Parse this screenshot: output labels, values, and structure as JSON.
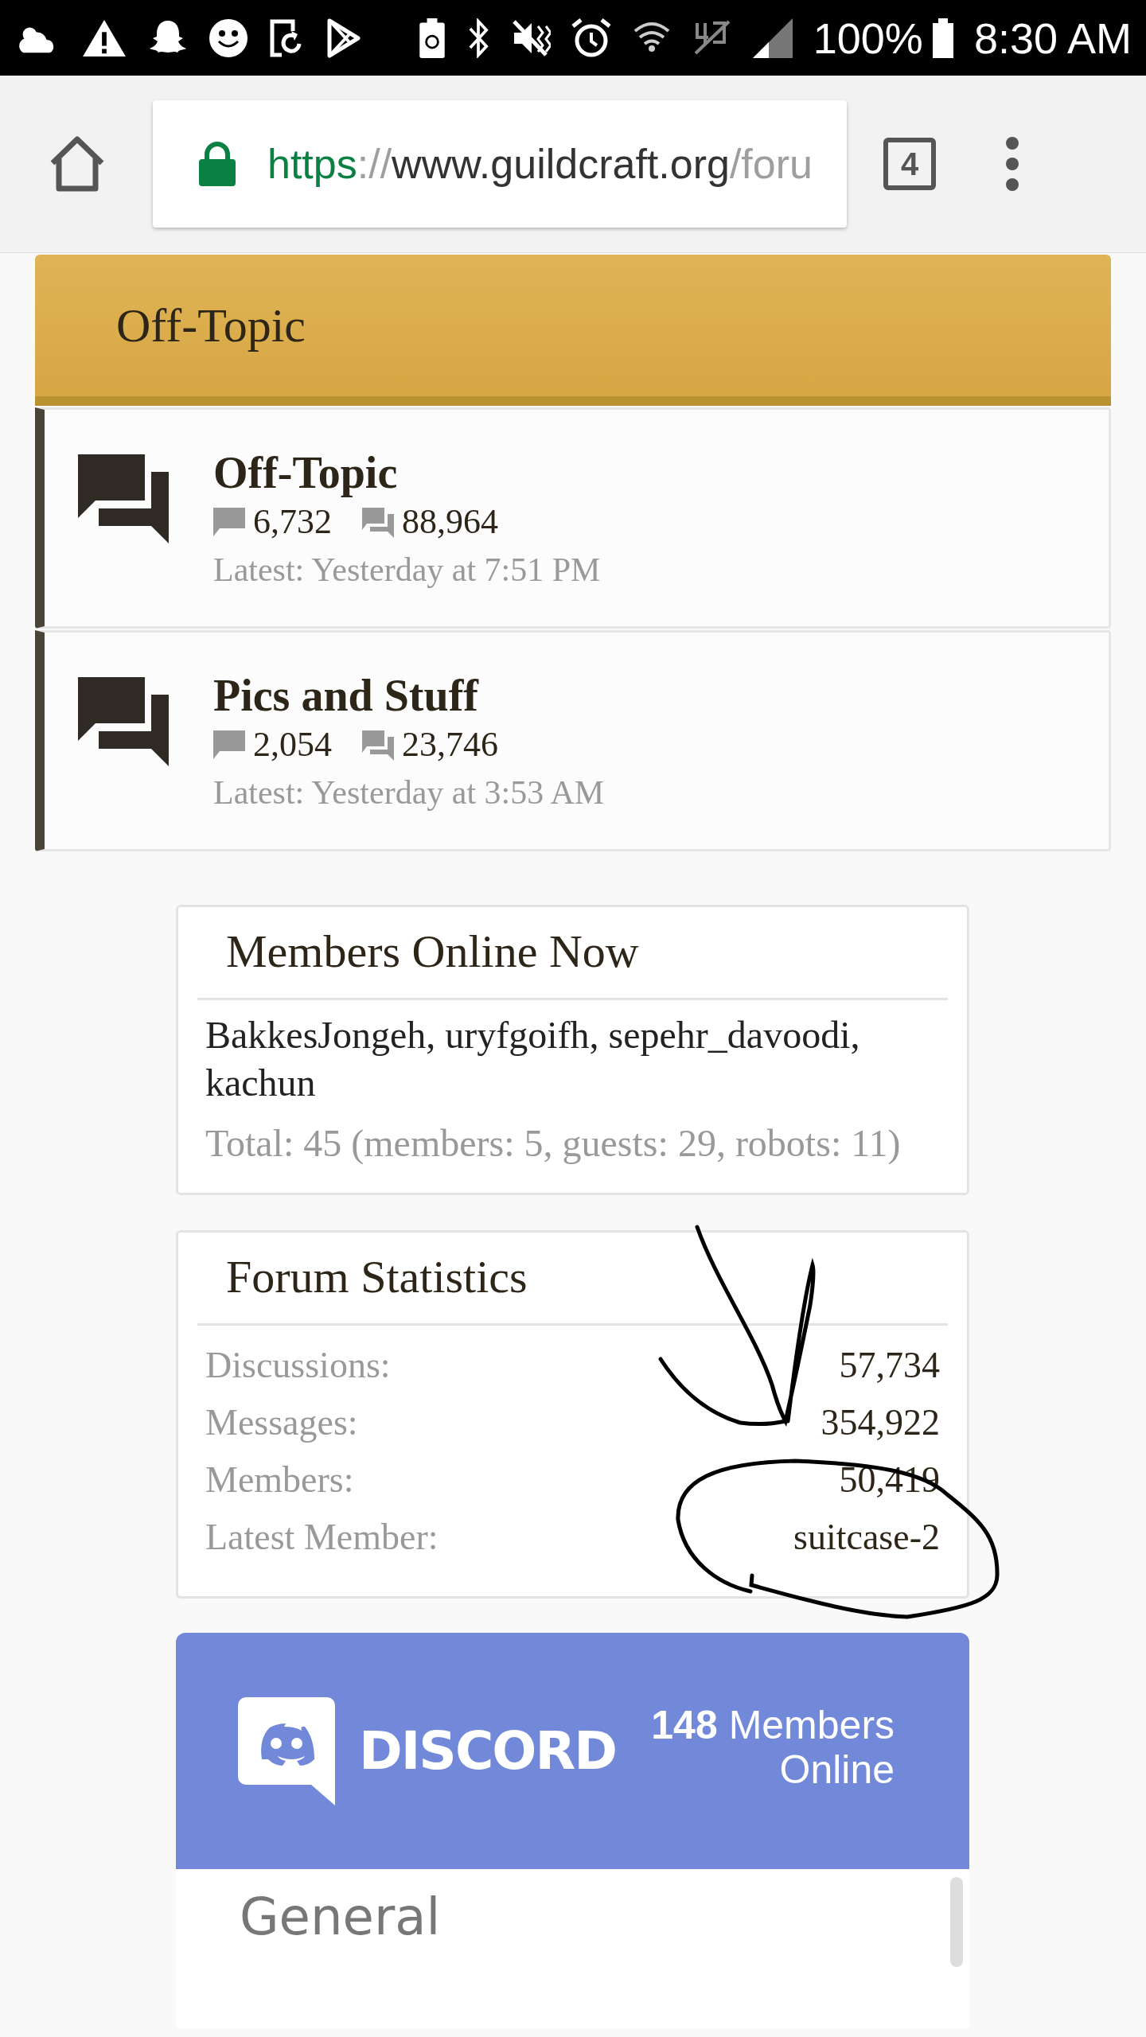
{
  "status_bar": {
    "battery": "100%",
    "time": "8:30 AM"
  },
  "browser": {
    "url": {
      "scheme": "https",
      "separator": "://",
      "host": "www.guildcraft.org",
      "path": "/foru"
    },
    "tab_count": "4"
  },
  "category": {
    "title": "Off-Topic"
  },
  "forums": [
    {
      "title": "Off-Topic",
      "threads": "6,732",
      "messages": "88,964",
      "latest": "Latest: Yesterday at 7:51 PM"
    },
    {
      "title": "Pics and Stuff",
      "threads": "2,054",
      "messages": "23,746",
      "latest": "Latest: Yesterday at 3:53 AM"
    }
  ],
  "members_online": {
    "title": "Members Online Now",
    "members": "BakkesJongeh, uryfgoifh, sepehr_davoodi, kachun",
    "total": "Total: 45 (members: 5, guests: 29, robots: 11)"
  },
  "forum_statistics": {
    "title": "Forum Statistics",
    "rows": [
      {
        "label": "Discussions:",
        "value": "57,734"
      },
      {
        "label": "Messages:",
        "value": "354,922"
      },
      {
        "label": "Members:",
        "value": "50,419"
      },
      {
        "label": "Latest Member:",
        "value": "suitcase-2"
      }
    ]
  },
  "discord": {
    "wordmark": "DISCORD",
    "count": "148",
    "label": "Members Online",
    "channel": "General"
  }
}
